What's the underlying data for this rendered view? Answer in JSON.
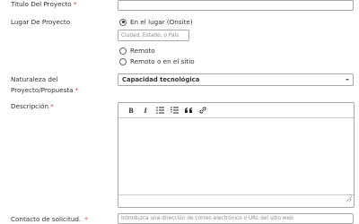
{
  "fields": {
    "titulo": {
      "label": "Titulo Del Proyecto",
      "required_mark": "*",
      "value": ""
    },
    "lugar": {
      "label": "Lugar De Proyecto",
      "options": [
        {
          "label": "En el lugar (Onsite)",
          "checked": true
        },
        {
          "label": "Remoto",
          "checked": false
        },
        {
          "label": "Remoto o en el sitio",
          "checked": false
        }
      ],
      "location_placeholder": "Ciudad, Estado, o País"
    },
    "naturaleza": {
      "label_line1": "Naturaleza del",
      "label_line2": "Proyecto/Propuesta",
      "required_mark": "*",
      "selected": "Capacidad tecnológica"
    },
    "descripcion": {
      "label": "Descripción",
      "required_mark": "*",
      "toolbar": [
        "bold-icon",
        "italic-icon",
        "bulleted-list-icon",
        "numbered-list-icon",
        "quote-icon",
        "link-icon"
      ],
      "toolbar_bold": "B",
      "toolbar_italic": "I"
    },
    "contacto": {
      "label": "Contacto de solicitud.",
      "required_mark": "*",
      "placeholder": "Introduzca una dirección de correo electrónico o URL del sitio web"
    }
  },
  "colors": {
    "required": "#d9363e",
    "border": "#a8a8a8",
    "text": "#333333"
  }
}
